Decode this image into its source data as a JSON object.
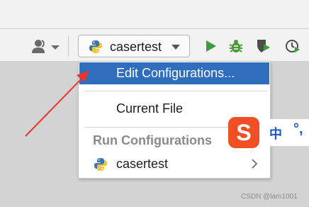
{
  "toolbar": {
    "run_config_label": "casertest",
    "icons": [
      "user-icon",
      "python-icon",
      "dropdown-arrow-icon",
      "run-icon",
      "debug-icon",
      "coverage-icon",
      "profile-icon"
    ],
    "run_color": "#3e9b3c",
    "debug_color": "#4a9b35"
  },
  "dropdown": {
    "edit_configurations": "Edit Configurations...",
    "current_file": "Current File",
    "run_configurations_header": "Run Configurations",
    "config_item": "casertest",
    "selected_color": "#2f6dbd"
  },
  "ime": {
    "logo": "S",
    "mode_char": "中",
    "punct": "°,"
  },
  "watermark": "CSDN @lam1001",
  "colors": {
    "annotation_arrow": "#e8362d",
    "ime_brand": "#f04e23"
  }
}
